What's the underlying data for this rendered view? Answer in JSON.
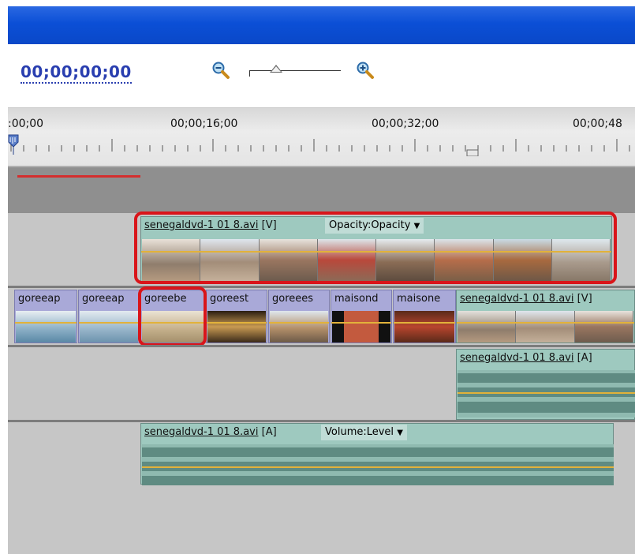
{
  "timecode": "00;00;00;00",
  "zoom": {
    "out_icon": "zoom-out-icon",
    "in_icon": "zoom-in-icon",
    "level": 0.3
  },
  "ruler": {
    "labels": [
      ":00;00",
      "00;00;16;00",
      "00;00;32;00",
      "00;00;48"
    ]
  },
  "tracks": {
    "video2": {
      "clip_file": "senegaldvd-1 01 8.avi",
      "clip_tag": "[V]",
      "effect": "Opacity:Opacity"
    },
    "video1": {
      "clips": [
        "goreeap",
        "goreeap",
        "goreebe",
        "goreest",
        "goreees",
        "maisond",
        "maisone"
      ],
      "long_clip_file": "senegaldvd-1 01 8.avi",
      "long_clip_tag": "[V]"
    },
    "audio1": {
      "clip_file": "senegaldvd-1 01 8.avi",
      "clip_tag": "[A]"
    },
    "audio2": {
      "clip_file": "senegaldvd-1 01 8.avi",
      "clip_tag": "[A]",
      "effect": "Volume:Level"
    }
  },
  "colors": {
    "highlight": "#d9151a",
    "clip_teal": "#9ec9bf",
    "clip_purple": "#a9a9d8",
    "keyframe_line": "#e2b23a"
  }
}
